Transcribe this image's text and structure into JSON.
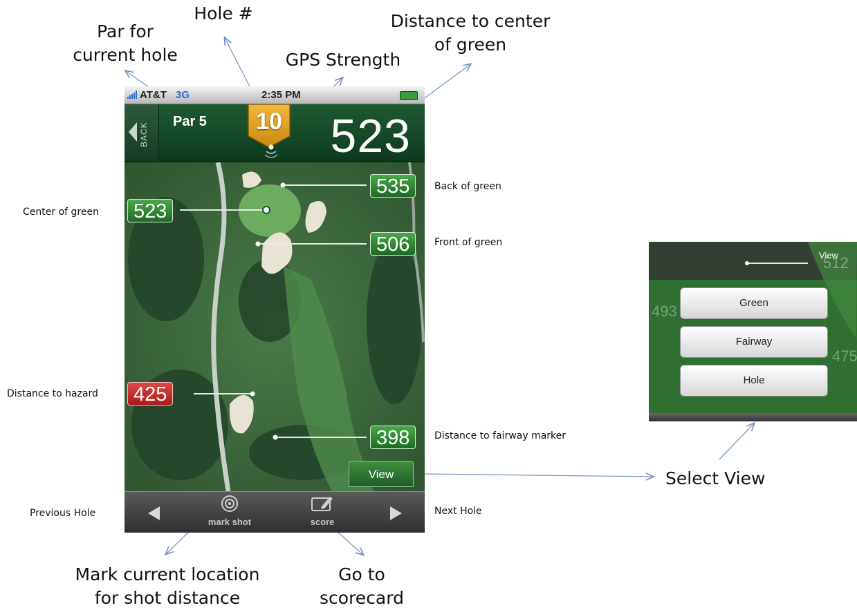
{
  "annotations": {
    "par": "Par for\ncurrent hole",
    "hole": "Hole #",
    "gps": "GPS Strength",
    "distance_center": "Distance to center\nof green",
    "back_of_green": "Back of green",
    "center_of_green": "Center of green",
    "front_of_green": "Front of green",
    "hazard": "Distance to hazard",
    "fairway_marker": "Distance to fairway marker",
    "previous_hole": "Previous Hole",
    "next_hole": "Next Hole",
    "mark_location": "Mark current location\nfor shot distance",
    "scorecard": "Go to\nscorecard",
    "select_view": "Select View"
  },
  "status": {
    "carrier": "AT&T",
    "network": "3G",
    "time": "2:35 PM"
  },
  "header": {
    "back": "BACK",
    "par": "Par 5",
    "hole_number": "10",
    "distance": "523"
  },
  "map": {
    "back_of_green": "535",
    "center_of_green": "523",
    "front_of_green": "506",
    "hazard": "425",
    "fairway_marker": "398",
    "view_button": "View"
  },
  "toolbar": {
    "mark_shot": "mark shot",
    "score": "score"
  },
  "inset": {
    "view_label": "View",
    "options": [
      "Green",
      "Fairway",
      "Hole"
    ],
    "ghost_numbers": [
      "512",
      "493",
      "475"
    ]
  },
  "colors": {
    "header_green": "#1e5a33",
    "flag_gold": "#e0a020",
    "tag_green": "#2f8a33",
    "tag_red": "#c62828"
  }
}
